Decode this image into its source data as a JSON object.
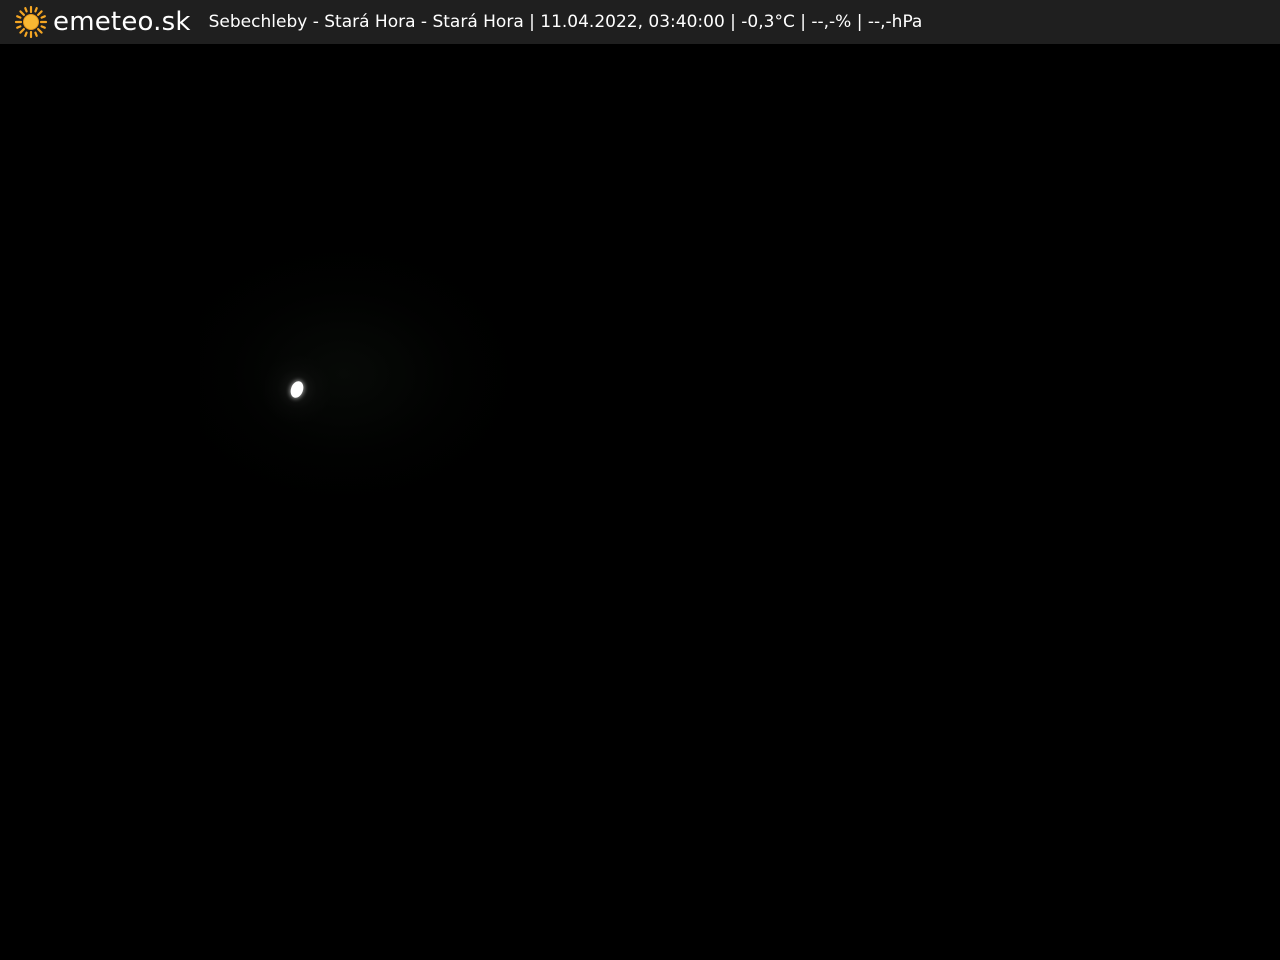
{
  "header": {
    "brand": "emeteo.sk",
    "logo_icon": "sun-icon",
    "caption": "Sebechleby - Stará Hora - Stará Hora | 11.04.2022, 03:40:00 | -0,3°C | --,-% | --,-hPa"
  },
  "scene": {
    "subject": "moon-light"
  },
  "colors": {
    "header_bg": "#1f1f1f",
    "sun": "#f5a623",
    "text": "#ffffff",
    "background": "#000000"
  }
}
